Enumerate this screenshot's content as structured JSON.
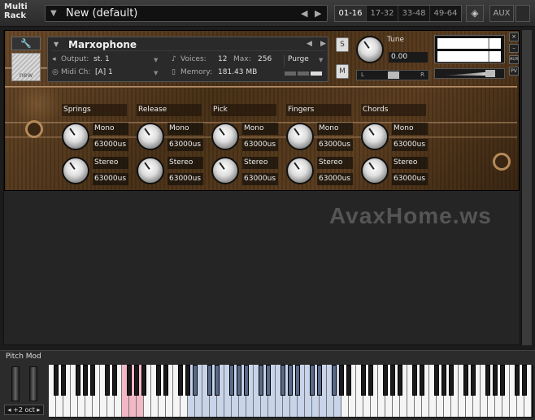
{
  "header": {
    "multi_rack_label": "Multi Rack",
    "rack_title": "New (default)",
    "page_tabs": [
      "01-16",
      "17-32",
      "33-48",
      "49-64"
    ],
    "aux_label": "AUX"
  },
  "instrument": {
    "name": "Marxophone",
    "output_label": "Output:",
    "output_value": "st. 1",
    "midi_label": "Midi Ch:",
    "midi_value": "[A] 1",
    "voices_label": "Voices:",
    "voices_value": "12",
    "max_label": "Max:",
    "max_value": "256",
    "memory_label": "Memory:",
    "memory_value": "181.43 MB",
    "purge_label": "Purge",
    "new_label": "new",
    "solo_label": "S",
    "mute_label": "M",
    "tune_label": "Tune",
    "tune_value": "0.00",
    "pan_left": "L",
    "pan_right": "R",
    "aux_side": "AUX",
    "pv_side": "PV"
  },
  "groups": [
    {
      "title": "Springs",
      "mono": "Mono",
      "mono_val": "63000us",
      "stereo": "Stereo",
      "stereo_val": "63000us"
    },
    {
      "title": "Release",
      "mono": "Mono",
      "mono_val": "63000us",
      "stereo": "Stereo",
      "stereo_val": "63000us"
    },
    {
      "title": "Pick",
      "mono": "Mono",
      "mono_val": "63000us",
      "stereo": "Stereo",
      "stereo_val": "63000us"
    },
    {
      "title": "Fingers",
      "mono": "Mono",
      "mono_val": "63000us",
      "stereo": "Stereo",
      "stereo_val": "63000us"
    },
    {
      "title": "Chords",
      "mono": "Mono",
      "mono_val": "63000us",
      "stereo": "Stereo",
      "stereo_val": "63000us"
    }
  ],
  "watermark": "AvaxHome.ws",
  "keyboard": {
    "pitch_mod_label": "Pitch Mod",
    "octave_label": "+2 oct"
  }
}
